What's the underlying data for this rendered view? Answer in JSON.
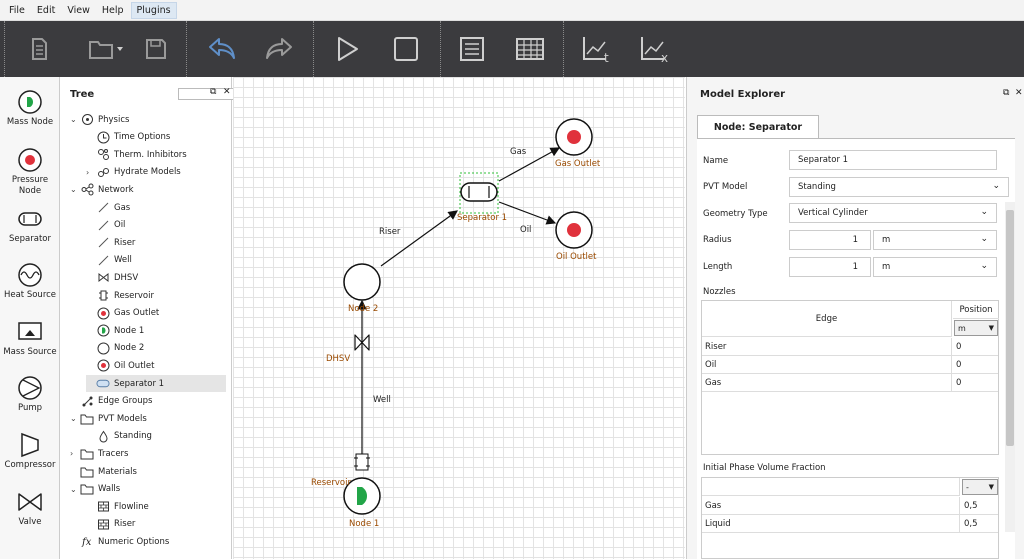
{
  "menu": {
    "items": [
      "File",
      "Edit",
      "View",
      "Help",
      "Plugins"
    ]
  },
  "toolbar": {
    "icons": [
      "new-document-icon",
      "open-folder-icon",
      "save-icon",
      "undo-icon",
      "redo-icon",
      "run-icon",
      "stop-icon",
      "text-list-icon",
      "table-icon",
      "chart-trend-t-icon",
      "chart-trend-x-icon"
    ]
  },
  "palette": {
    "items": [
      {
        "label": "Mass Node",
        "icon": "mass-node-icon"
      },
      {
        "label": "Pressure",
        "label2": "Node",
        "icon": "pressure-node-icon"
      },
      {
        "label": "Separator",
        "icon": "separator-icon"
      },
      {
        "label": "Heat Source",
        "icon": "heat-source-icon"
      },
      {
        "label": "Mass Source",
        "icon": "mass-source-icon"
      },
      {
        "label": "Pump",
        "icon": "pump-icon"
      },
      {
        "label": "Compressor",
        "icon": "compressor-icon"
      },
      {
        "label": "Valve",
        "icon": "valve-icon"
      }
    ]
  },
  "tree": {
    "title": "Tree",
    "items": [
      {
        "label": "Physics",
        "level": 0,
        "expander": "open",
        "icon": "physics-icon"
      },
      {
        "label": "Time Options",
        "level": 1,
        "expander": "",
        "icon": "clock-icon"
      },
      {
        "label": "Therm. Inhibitors",
        "level": 1,
        "expander": "",
        "icon": "molecule-icon"
      },
      {
        "label": "Hydrate Models",
        "level": 1,
        "expander": "closed",
        "icon": "hydrate-icon"
      },
      {
        "label": "Network",
        "level": 0,
        "expander": "open",
        "icon": "network-icon"
      },
      {
        "label": "Gas",
        "level": 1,
        "expander": "",
        "icon": "edge-line-icon"
      },
      {
        "label": "Oil",
        "level": 1,
        "expander": "",
        "icon": "edge-line-icon"
      },
      {
        "label": "Riser",
        "level": 1,
        "expander": "",
        "icon": "edge-line-icon"
      },
      {
        "label": "Well",
        "level": 1,
        "expander": "",
        "icon": "edge-line-icon"
      },
      {
        "label": "DHSV",
        "level": 1,
        "expander": "",
        "icon": "valve-icon"
      },
      {
        "label": "Reservoir",
        "level": 1,
        "expander": "",
        "icon": "reservoir-icon"
      },
      {
        "label": "Gas Outlet",
        "level": 1,
        "expander": "",
        "icon": "pressure-node-icon"
      },
      {
        "label": "Node 1",
        "level": 1,
        "expander": "",
        "icon": "mass-node-icon"
      },
      {
        "label": "Node 2",
        "level": 1,
        "expander": "",
        "icon": "node-circle-icon"
      },
      {
        "label": "Oil Outlet",
        "level": 1,
        "expander": "",
        "icon": "pressure-node-icon"
      },
      {
        "label": "Separator 1",
        "level": 1,
        "expander": "",
        "icon": "separator-icon",
        "selected": true
      },
      {
        "label": "Edge Groups",
        "level": 0,
        "expander": "",
        "icon": "edge-groups-icon"
      },
      {
        "label": "PVT Models",
        "level": 0,
        "expander": "open",
        "icon": "folder-icon"
      },
      {
        "label": "Standing",
        "level": 1,
        "expander": "",
        "icon": "droplet-icon"
      },
      {
        "label": "Tracers",
        "level": 0,
        "expander": "closed",
        "icon": "folder-icon"
      },
      {
        "label": "Materials",
        "level": 0,
        "expander": "",
        "icon": "folder-icon"
      },
      {
        "label": "Walls",
        "level": 0,
        "expander": "open",
        "icon": "folder-icon"
      },
      {
        "label": "Flowline",
        "level": 1,
        "expander": "",
        "icon": "wall-icon"
      },
      {
        "label": "Riser",
        "level": 1,
        "expander": "",
        "icon": "wall-icon"
      },
      {
        "label": "Numeric Options",
        "level": 0,
        "expander": "",
        "icon": "fx-icon"
      }
    ]
  },
  "canvas": {
    "edges": {
      "gas": "Gas",
      "oil": "Oil",
      "riser": "Riser",
      "well": "Well",
      "dhsv": "DHSV"
    },
    "nodes": {
      "gas_outlet": "Gas Outlet",
      "oil_outlet": "Oil Outlet",
      "separator": "Separator 1",
      "node2": "Node 2",
      "reservoir": "Reservoir",
      "node1": "Node 1"
    }
  },
  "explorer": {
    "title": "Model Explorer",
    "tab": "Node: Separator",
    "fields": {
      "name_label": "Name",
      "name_value": "Separator 1",
      "pvt_label": "PVT Model",
      "pvt_value": "Standing",
      "geom_label": "Geometry Type",
      "geom_value": "Vertical Cylinder",
      "radius_label": "Radius",
      "radius_value": "1",
      "radius_unit": "m",
      "length_label": "Length",
      "length_value": "1",
      "length_unit": "m"
    },
    "nozzles": {
      "title": "Nozzles",
      "col_edge": "Edge",
      "col_position": "Position",
      "position_unit": "m",
      "rows": [
        {
          "edge": "Riser",
          "position": "0"
        },
        {
          "edge": "Oil",
          "position": "0"
        },
        {
          "edge": "Gas",
          "position": "0"
        }
      ]
    },
    "ipvf": {
      "title": "Initial Phase Volume Fraction",
      "unit": "-",
      "rows": [
        {
          "phase": "Gas",
          "value": "0,5"
        },
        {
          "phase": "Liquid",
          "value": "0,5"
        }
      ]
    }
  },
  "colors": {
    "toolbar_bg": "#3b3b3e",
    "accent_red": "#e0323c",
    "mass_green": "#22a548",
    "label_brown": "#9a4a00",
    "undo_blue": "#5f8fc8"
  }
}
